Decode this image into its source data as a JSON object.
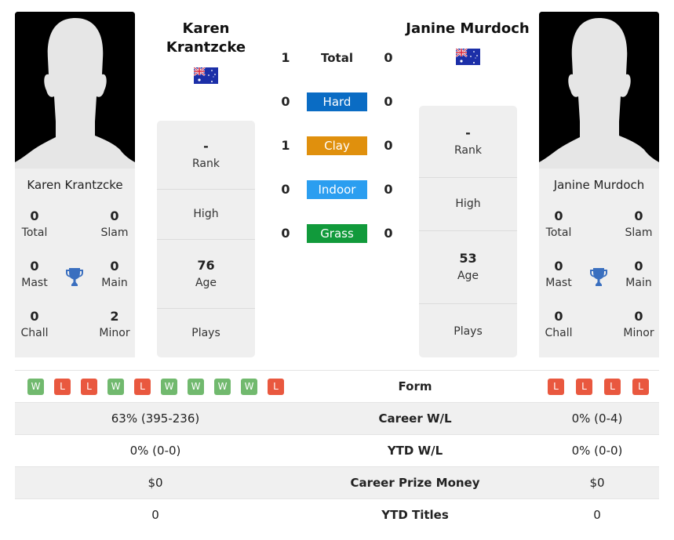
{
  "colors": {
    "hard": "#0a6cc4",
    "clay": "#e0900d",
    "indoor": "#2b9ef0",
    "grass": "#119a3b",
    "win": "#71b96e",
    "loss": "#e9583f",
    "trophy": "#3a6fbf"
  },
  "player_left": {
    "name": "Karen Krantzcke",
    "flag": "australia-flag",
    "titles": {
      "total": {
        "value": "0",
        "label": "Total"
      },
      "slam": {
        "value": "0",
        "label": "Slam"
      },
      "mast": {
        "value": "0",
        "label": "Mast"
      },
      "main": {
        "value": "0",
        "label": "Main"
      },
      "chall": {
        "value": "0",
        "label": "Chall"
      },
      "minor": {
        "value": "2",
        "label": "Minor"
      }
    },
    "info": {
      "rank": {
        "value": "-",
        "label": "Rank"
      },
      "high": {
        "value": "",
        "label": "High"
      },
      "age": {
        "value": "76",
        "label": "Age"
      },
      "plays": {
        "value": "",
        "label": "Plays"
      }
    }
  },
  "player_right": {
    "name": "Janine Murdoch",
    "flag": "australia-flag",
    "titles": {
      "total": {
        "value": "0",
        "label": "Total"
      },
      "slam": {
        "value": "0",
        "label": "Slam"
      },
      "mast": {
        "value": "0",
        "label": "Mast"
      },
      "main": {
        "value": "0",
        "label": "Main"
      },
      "chall": {
        "value": "0",
        "label": "Chall"
      },
      "minor": {
        "value": "0",
        "label": "Minor"
      }
    },
    "info": {
      "rank": {
        "value": "-",
        "label": "Rank"
      },
      "high": {
        "value": "",
        "label": "High"
      },
      "age": {
        "value": "53",
        "label": "Age"
      },
      "plays": {
        "value": "",
        "label": "Plays"
      }
    }
  },
  "h2h": [
    {
      "label": "Total",
      "left": "1",
      "right": "0",
      "surface": "total"
    },
    {
      "label": "Hard",
      "left": "0",
      "right": "0",
      "surface": "hard"
    },
    {
      "label": "Clay",
      "left": "1",
      "right": "0",
      "surface": "clay"
    },
    {
      "label": "Indoor",
      "left": "0",
      "right": "0",
      "surface": "indoor"
    },
    {
      "label": "Grass",
      "left": "0",
      "right": "0",
      "surface": "grass"
    }
  ],
  "comparison": {
    "form": {
      "label": "Form",
      "left": [
        "W",
        "L",
        "L",
        "W",
        "L",
        "W",
        "W",
        "W",
        "W",
        "L"
      ],
      "right": [
        "L",
        "L",
        "L",
        "L"
      ]
    },
    "rows": [
      {
        "label": "Career W/L",
        "left": "63% (395-236)",
        "right": "0% (0-4)"
      },
      {
        "label": "YTD W/L",
        "left": "0% (0-0)",
        "right": "0% (0-0)"
      },
      {
        "label": "Career Prize Money",
        "left": "$0",
        "right": "$0"
      },
      {
        "label": "YTD Titles",
        "left": "0",
        "right": "0"
      }
    ]
  }
}
